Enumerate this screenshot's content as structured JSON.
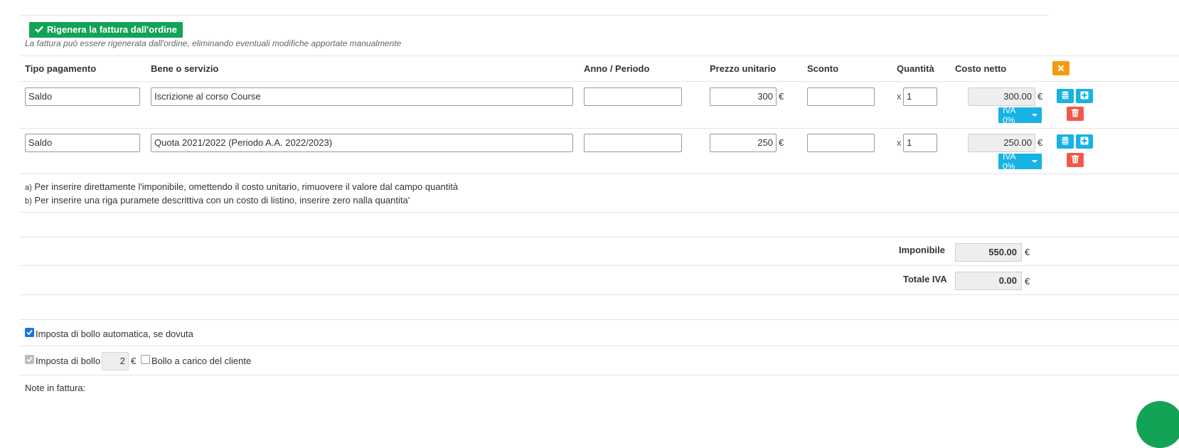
{
  "regen_button": {
    "label": "Rigenera la fattura dall'ordine",
    "icon": "check-icon"
  },
  "regen_note": "La fattura può essere rigenerata dall'ordine, eliminando eventuali modifiche apportate manualmente",
  "table": {
    "headers": {
      "tipo_pagamento": "Tipo pagamento",
      "bene_servizio": "Bene o servizio",
      "anno_periodo": "Anno / Periodo",
      "prezzo_unitario": "Prezzo unitario",
      "sconto": "Sconto",
      "quantita": "Quantità",
      "costo_netto": "Costo netto"
    },
    "rows": [
      {
        "tipo": "Saldo",
        "bene": "Iscrizione al corso Course",
        "anno": "",
        "prezzo": "300",
        "sconto": "",
        "quantita": "1",
        "costo": "300.00",
        "iva": "IVA 0%"
      },
      {
        "tipo": "Saldo",
        "bene": "Quota 2021/2022 (Periodo A.A. 2022/2023)",
        "anno": "",
        "prezzo": "250",
        "sconto": "",
        "quantita": "1",
        "costo": "250.00",
        "iva": "IVA 0%"
      }
    ],
    "currency": "€",
    "multiply": "x"
  },
  "hints": {
    "a_prefix": "a)",
    "a_text": "Per inserire direttamente l'imponibile, omettendo il costo unitario, rimuovere il valore dal campo quantità",
    "b_prefix": "b)",
    "b_text": "Per inserire una riga puramete descrittiva con un costo di listino, inserire zero nalla quantita'"
  },
  "totals": {
    "imponibile_label": "Imponibile",
    "imponibile_value": "550.00",
    "iva_label": "Totale IVA",
    "iva_value": "0.00"
  },
  "bollo": {
    "auto_label": "Imposta di bollo automatica, se dovuta",
    "auto_checked": true,
    "imposta_label": "Imposta di bollo",
    "imposta_value": "2",
    "carico_label": "Bollo a carico del cliente",
    "carico_checked": false
  },
  "note_label": "Note in fattura:",
  "colors": {
    "green": "#12a356",
    "cyan": "#16b3e4",
    "red": "#ef5a47",
    "orange": "#f39c12"
  }
}
